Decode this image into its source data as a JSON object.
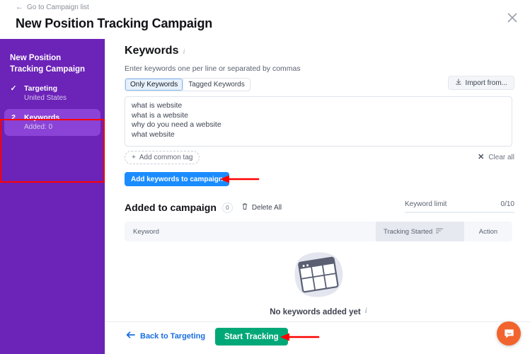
{
  "topbar": {
    "back_link": "Go to Campaign list",
    "back_arrow_icon": "arrow-left-icon",
    "title": "New Position Tracking Campaign",
    "close_icon": "close-icon"
  },
  "sidebar": {
    "title": "New Position Tracking Campaign",
    "steps": [
      {
        "mark": "✓",
        "label": "Targeting",
        "sub": "United States",
        "active": false
      },
      {
        "mark": "2",
        "label": "Keywords",
        "sub": "Added: 0",
        "active": true
      }
    ]
  },
  "main": {
    "section_title": "Keywords",
    "info_icon": "info-icon",
    "helper_text": "Enter keywords one per line or separated by commas",
    "tabs": [
      {
        "label": "Only Keywords",
        "selected": true
      },
      {
        "label": "Tagged Keywords",
        "selected": false
      }
    ],
    "import_button": {
      "label": "Import from...",
      "icon": "download-icon"
    },
    "keywords_textarea": {
      "value": "what is website\nwhat is a website\nwhy do you need a website\nwhat website",
      "placeholder": "Enter keywords"
    },
    "add_common_tag": {
      "label": "Add common tag",
      "icon": "plus-icon"
    },
    "clear_all": {
      "label": "Clear all",
      "icon": "x-icon"
    },
    "add_keywords_button": "Add keywords to campaign"
  },
  "added": {
    "title": "Added to campaign",
    "count": "0",
    "delete_all": {
      "label": "Delete All",
      "icon": "trash-icon"
    },
    "keyword_limit": {
      "label": "Keyword limit",
      "value": "0/10"
    },
    "table_headers": {
      "keyword": "Keyword",
      "tracking_started": "Tracking Started",
      "sort_icon": "sort-descending-icon",
      "action": "Action"
    },
    "rows": [],
    "empty_state": {
      "illustration_icon": "empty-table-icon",
      "text": "No keywords added yet",
      "info_icon": "info-icon"
    }
  },
  "footer": {
    "back_button": {
      "label": "Back to Targeting",
      "icon": "arrow-left-icon"
    },
    "start_button": "Start Tracking"
  },
  "widgets": {
    "intercom_icon": "chat-bubble-icon"
  },
  "annotations": {
    "highlight_color": "#ff0000",
    "arrow_add_keywords": "arrow pointing left at Add keywords to campaign button",
    "arrow_start_tracking": "arrow pointing left at Start Tracking button",
    "box_sidebar_steps": "red rectangle around sidebar steps"
  },
  "colors": {
    "sidebar_purple": "#6c23b8",
    "step_active_purple": "#8a43d6",
    "primary_blue": "#1a8cff",
    "success_green": "#00a878",
    "intercom_orange": "#f2642d"
  }
}
